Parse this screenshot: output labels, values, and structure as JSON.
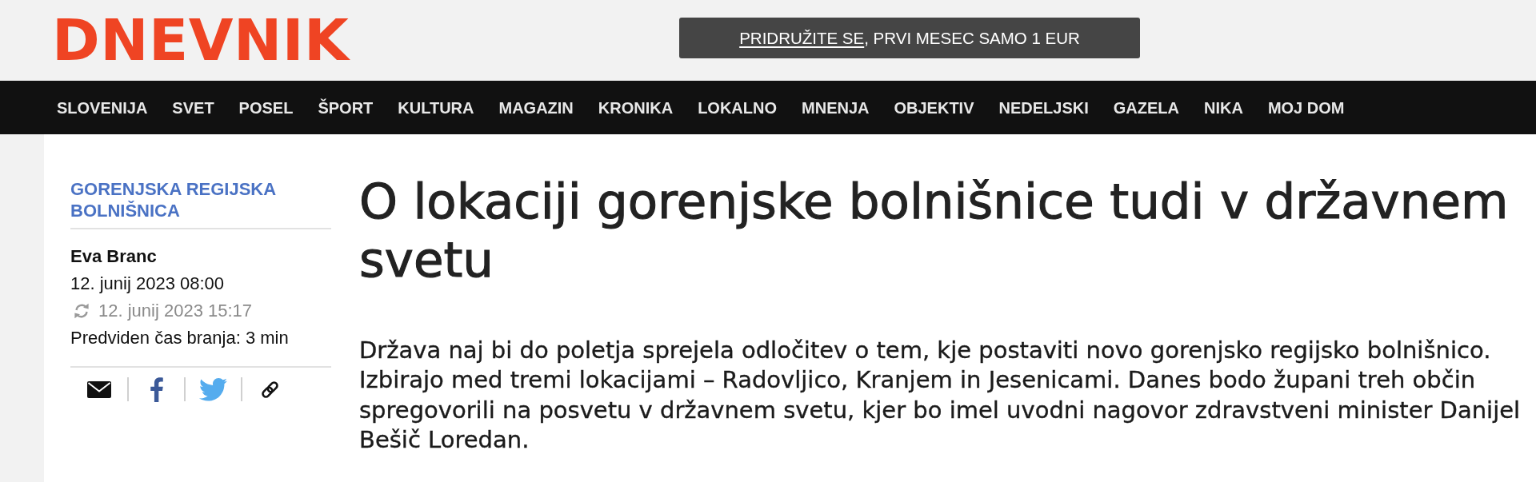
{
  "header": {
    "logo": "DNEVNIK",
    "promo": {
      "link": "PRIDRUŽITE SE",
      "text": ", PRVI MESEC SAMO 1 EUR"
    }
  },
  "nav": [
    "SLOVENIJA",
    "SVET",
    "POSEL",
    "ŠPORT",
    "KULTURA",
    "MAGAZIN",
    "KRONIKA",
    "LOKALNO",
    "MNENJA",
    "OBJEKTIV",
    "NEDELJSKI",
    "GAZELA",
    "NIKA",
    "MOJ DOM"
  ],
  "article": {
    "category": "GORENJSKA REGIJSKA BOLNIŠNICA",
    "author": "Eva Branc",
    "published": "12. junij 2023 08:00",
    "updated": "12. junij 2023 15:17",
    "reading_time": "Predviden čas branja: 3 min",
    "share": [
      {
        "kind": "email"
      },
      {
        "kind": "facebook"
      },
      {
        "kind": "twitter"
      },
      {
        "kind": "link"
      }
    ],
    "title": "O lokaciji gorenjske bolnišnice tudi v državnem svetu",
    "lead": "Država naj bi do poletja sprejela odločitev o tem, kje postaviti novo gorenjsko regijsko bolnišnico. Izbirajo med tremi lokacijami – Radovljico, Kranjem in Jesenicami. Danes bodo župani treh občin spregovorili na posvetu v državnem svetu, kjer bo imel uvodni nagovor zdravstveni minister Danijel Bešič Loredan."
  }
}
